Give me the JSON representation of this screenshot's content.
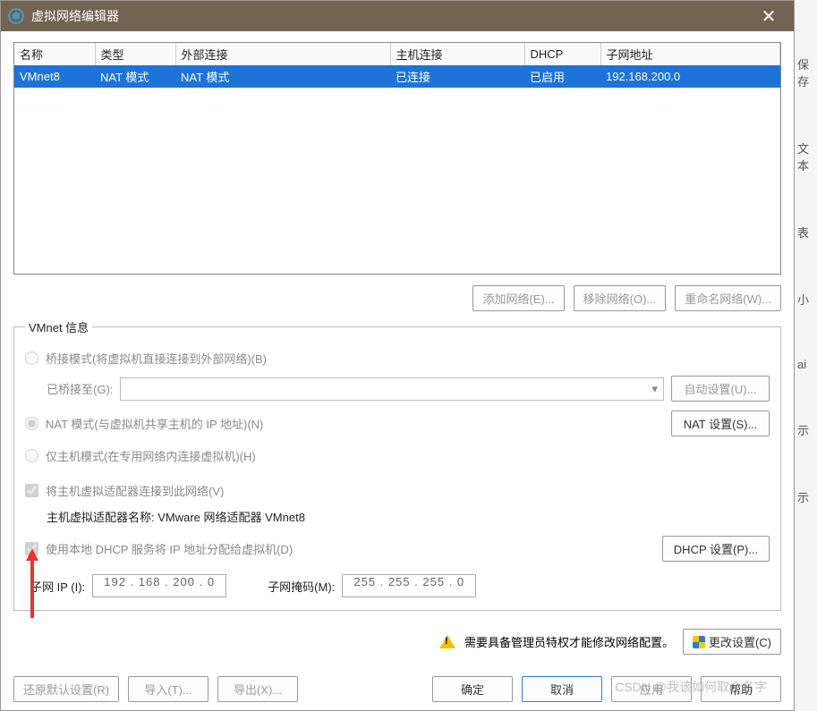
{
  "title": "虚拟网络编辑器",
  "table": {
    "headers": [
      "名称",
      "类型",
      "外部连接",
      "主机连接",
      "DHCP",
      "子网地址"
    ],
    "rows": [
      {
        "name": "VMnet8",
        "type": "NAT 模式",
        "external": "NAT 模式",
        "host": "已连接",
        "dhcp": "已启用",
        "subnet": "192.168.200.0"
      }
    ]
  },
  "buttons": {
    "add_network": "添加网络(E)...",
    "remove_network": "移除网络(O)...",
    "rename_network": "重命名网络(W)...",
    "auto_settings": "自动设置(U)...",
    "nat_settings": "NAT 设置(S)...",
    "dhcp_settings": "DHCP 设置(P)...",
    "change_settings": "更改设置(C)",
    "restore_defaults": "还原默认设置(R)",
    "import": "导入(T)...",
    "export": "导出(X)...",
    "ok": "确定",
    "cancel": "取消",
    "apply": "应用",
    "help": "帮助"
  },
  "vmnet": {
    "legend": "VMnet 信息",
    "bridge_label": "桥接模式(将虚拟机直接连接到外部网络)(B)",
    "bridged_to_label": "已桥接至(G):",
    "nat_label": "NAT 模式(与虚拟机共享主机的 IP 地址)(N)",
    "hostonly_label": "仅主机模式(在专用网络内连接虚拟机)(H)",
    "connect_host_adapter": "将主机虚拟适配器连接到此网络(V)",
    "adapter_name_label": "主机虚拟适配器名称: VMware 网络适配器 VMnet8",
    "use_dhcp": "使用本地 DHCP 服务将 IP 地址分配给虚拟机(D)",
    "subnet_ip_label": "子网 IP (I):",
    "subnet_ip_value": "192 . 168 . 200 .   0",
    "subnet_mask_label": "子网掩码(M):",
    "subnet_mask_value": "255 . 255 . 255 .   0"
  },
  "warning": "需要具备管理员特权才能修改网络配置。",
  "watermark": "CSDN @我该如何取个名字",
  "side_hints": [
    "保存",
    "文本",
    "表",
    "小",
    "ai",
    "示",
    "示"
  ]
}
